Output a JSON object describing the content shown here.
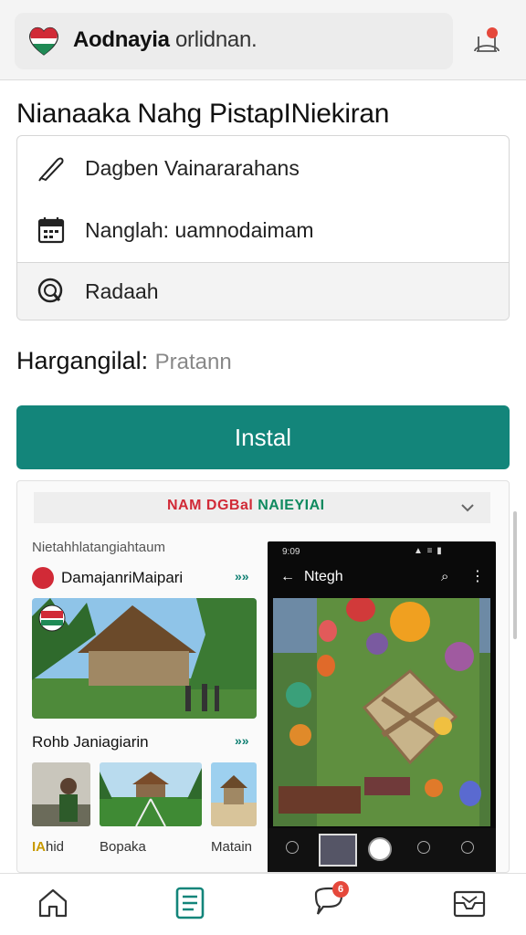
{
  "header": {
    "app_name_bold": "Aodnayia",
    "app_name_light": "orlidnan.",
    "logo_icon": "flag-heart-logo-icon",
    "action_icon": "bell-notification-icon",
    "action_badge_color": "#e5483b"
  },
  "page": {
    "title": "Nianaaka Nahg PistapINiekiran"
  },
  "options": [
    {
      "icon": "feather-pen-icon",
      "label": "Dagben Vainararahans"
    },
    {
      "icon": "calendar-icon",
      "label": "Nanglah: uamnodaimam"
    },
    {
      "icon": "search-magnifier-icon",
      "label": "Radaah"
    }
  ],
  "price": {
    "label": "Hargangilal:",
    "value": "Pratann"
  },
  "install": {
    "label": "Instal",
    "color": "#13857a"
  },
  "preview": {
    "header_red": "NAM DGBal",
    "header_green": "NAIEYIAI",
    "caption": "Nietahhlatangiahtaum",
    "section1_title": "DamajanriMaipari",
    "section1_more": "»»",
    "section2_title": "Rohb Janiagiarin",
    "section2_more": "»»",
    "thumb_labels": [
      "hid",
      "Bopaka",
      "Matain"
    ],
    "thumb_label1_prefix": "IA",
    "phone": {
      "time": "9:09",
      "status": "▲ ≡ ▮",
      "title": "Ntegh",
      "back": "←",
      "search": "⌕",
      "more": "⋮"
    }
  },
  "bottom_nav": [
    {
      "name": "home",
      "icon": "home-icon"
    },
    {
      "name": "list",
      "icon": "list-document-icon"
    },
    {
      "name": "chat",
      "icon": "chat-bubble-icon",
      "badge": "6"
    },
    {
      "name": "mail",
      "icon": "mail-icon"
    }
  ]
}
